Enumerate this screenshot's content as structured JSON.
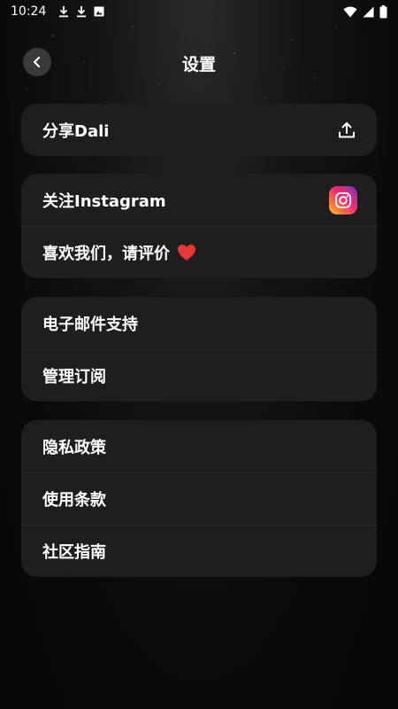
{
  "status_bar": {
    "time": "10:24",
    "icons": [
      "download-icon",
      "download-icon",
      "photo-icon",
      "wifi-icon",
      "battery-icon"
    ]
  },
  "header": {
    "back_icon": "chevron-left-icon",
    "title": "设置"
  },
  "cards": [
    {
      "items": [
        {
          "label": "分享Dali",
          "trailing_icon": "share-upload-icon"
        }
      ]
    },
    {
      "items": [
        {
          "label": "关注Instagram",
          "trailing_icon": "instagram-icon"
        },
        {
          "label": "喜欢我们，请评价",
          "inline_icon": "heart-icon"
        }
      ]
    },
    {
      "items": [
        {
          "label": "电子邮件支持"
        },
        {
          "label": "管理订阅"
        }
      ]
    },
    {
      "items": [
        {
          "label": "隐私政策"
        },
        {
          "label": "使用条款"
        },
        {
          "label": "社区指南"
        }
      ]
    }
  ],
  "colors": {
    "background": "#0b0b0b",
    "card": "#1e1e1e",
    "divider": "#2b2b2b",
    "heart": "#e53935",
    "back_button": "#3a3a3a"
  }
}
